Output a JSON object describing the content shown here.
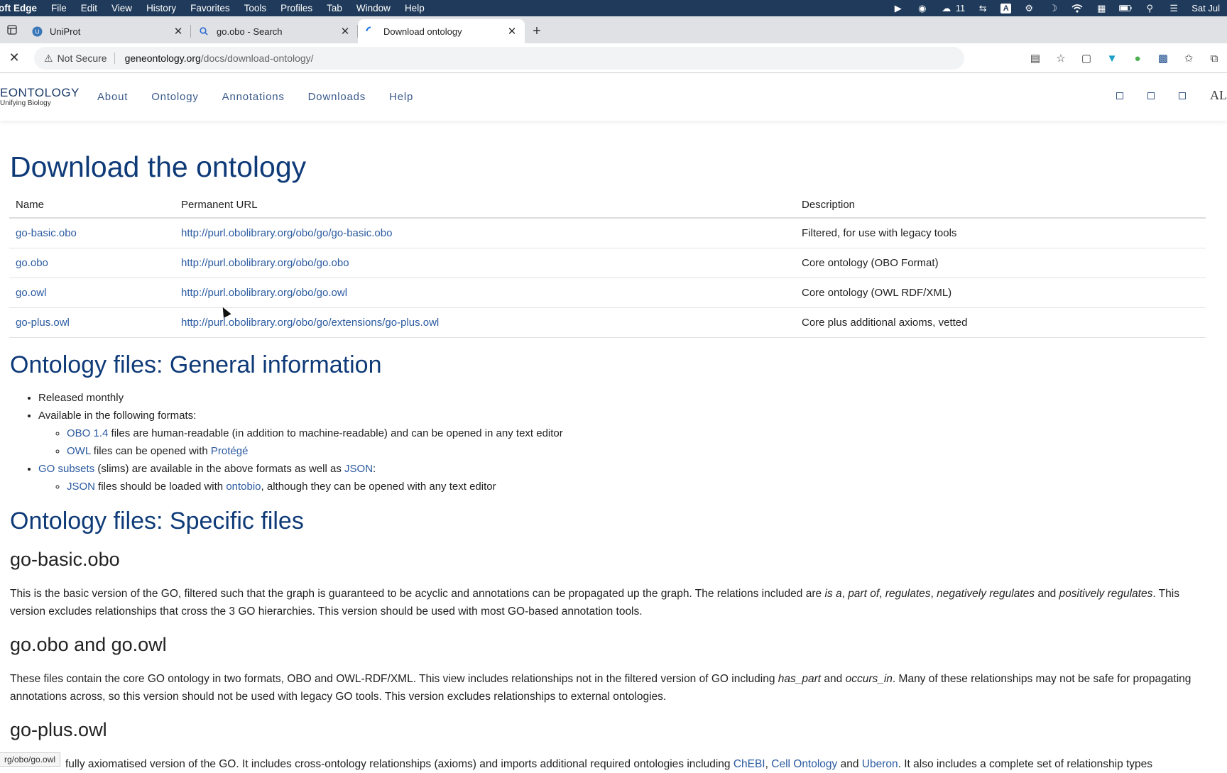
{
  "menubar": {
    "app": "oft Edge",
    "items": [
      "File",
      "Edit",
      "View",
      "History",
      "Favorites",
      "Tools",
      "Profiles",
      "Tab",
      "Window",
      "Help"
    ],
    "wechat_count": "11",
    "clock": "Sat Jul"
  },
  "tabs": [
    {
      "title": "UniProt",
      "icon": "uniprot-icon"
    },
    {
      "title": "go.obo - Search",
      "icon": "search-icon"
    },
    {
      "title": "Download ontology",
      "icon": "loading-icon"
    }
  ],
  "address": {
    "security": "Not Secure",
    "domain": "geneontology.org",
    "path": "/docs/download-ontology/"
  },
  "site": {
    "logo_line1": "EONTOLOGY",
    "logo_line2": "Unifying Biology",
    "nav": [
      "About",
      "Ontology",
      "Annotations",
      "Downloads",
      "Help"
    ],
    "alliance_text": "ALL"
  },
  "page": {
    "title": "Download the ontology",
    "table": {
      "headers": [
        "Name",
        "Permanent URL",
        "Description"
      ],
      "rows": [
        {
          "name": "go-basic.obo",
          "url": "http://purl.obolibrary.org/obo/go/go-basic.obo",
          "desc": "Filtered, for use with legacy tools"
        },
        {
          "name": "go.obo",
          "url": "http://purl.obolibrary.org/obo/go.obo",
          "desc": "Core ontology (OBO Format)"
        },
        {
          "name": "go.owl",
          "url": "http://purl.obolibrary.org/obo/go.owl",
          "desc": "Core ontology (OWL RDF/XML)"
        },
        {
          "name": "go-plus.owl",
          "url": "http://purl.obolibrary.org/obo/go/extensions/go-plus.owl",
          "desc": "Core plus additional axioms, vetted"
        }
      ]
    },
    "general_heading": "Ontology files: General information",
    "general": {
      "released": "Released monthly",
      "formats_intro": "Available in the following formats:",
      "obo_link": "OBO 1.4",
      "obo_text": " files are human-readable (in addition to machine-readable) and can be opened in any text editor",
      "owl_link": "OWL",
      "owl_text": " files can be opened with ",
      "protege_link": "Protégé",
      "subsets_link": "GO subsets",
      "subsets_text": " (slims) are available in the above formats as well as ",
      "json_link": "JSON",
      "colon": ":",
      "json_link2": "JSON",
      "json_text": " files should be loaded with ",
      "ontobio_link": "ontobio",
      "json_text2": ", although they can be opened with any text editor"
    },
    "specific_heading": "Ontology files: Specific files",
    "basic_heading": "go-basic.obo",
    "basic": {
      "t1": "This is the basic version of the GO, filtered such that the graph is guaranteed to be acyclic and annotations can be propagated up the graph. The relations included are ",
      "r1": "is a",
      "c1": ", ",
      "r2": "part of",
      "c2": ", ",
      "r3": "regulates",
      "c3": ", ",
      "r4": "negatively regulates",
      "and": " and ",
      "r5": "positively regulates",
      "t2": ". This version excludes relationships that cross the 3 GO hierarchies. This version should be used with most GO-based annotation tools."
    },
    "obo_owl_heading": "go.obo and go.owl",
    "obo_owl": {
      "t1": "These files contain the core GO ontology in two formats, OBO and OWL-RDF/XML. This view includes relationships not in the filtered version of GO including ",
      "r1": "has_part",
      "and": " and ",
      "r2": "occurs_in",
      "t2": ". Many of these relationships may not be safe for propagating annotations across, so this version should not be used with legacy GO tools. This version excludes relationships to external ontologies."
    },
    "plus_heading": "go-plus.owl",
    "plus": {
      "t1": "fully axiomatised version of the GO. It includes cross-ontology relationships (axioms) and imports additional required ontologies including ",
      "l1": "ChEBI",
      "c1": ", ",
      "l2": "Cell Ontology",
      "and": " and ",
      "l3": "Uberon",
      "t2": ". It also includes a complete set of relationship types"
    }
  },
  "statusbar": "rg/obo/go.owl"
}
